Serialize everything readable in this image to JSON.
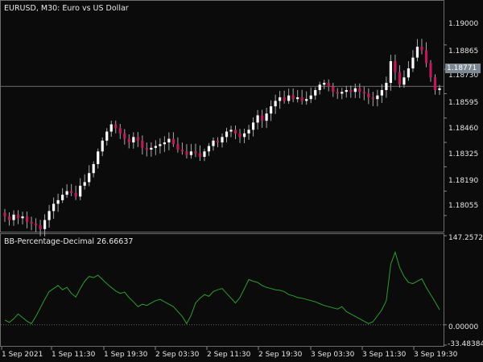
{
  "price_title": "EURUSD, M30:  Euro vs US Dollar",
  "indicator_title": "BB-Percentage-Decimal 26.66637",
  "price_axis": [
    "1.19000",
    "1.18865",
    "1.18730",
    "1.18595",
    "1.18460",
    "1.18325",
    "1.18190",
    "1.18055"
  ],
  "current_price": "1.18771",
  "indicator_axis": [
    "147.25722",
    "0.00000",
    "-33.48384"
  ],
  "time_axis": [
    "1 Sep 2021",
    "1 Sep 11:30",
    "1 Sep 19:30",
    "2 Sep 03:30",
    "2 Sep 11:30",
    "2 Sep 19:30",
    "3 Sep 03:30",
    "3 Sep 11:30",
    "3 Sep 19:30"
  ],
  "colors": {
    "bull": "#ffffff",
    "bear": "#c2185b",
    "wick": "#a8a8a8",
    "indicator": "#2e9e2e",
    "zero": "#666666"
  },
  "chart_data": {
    "type": "candlestick+line",
    "symbol": "EURUSD",
    "timeframe": "M30",
    "price_ylim": [
      1.1797,
      1.1924
    ],
    "indicator_ylim": [
      -33.48384,
      147.25722
    ],
    "current_price": 1.18771,
    "closes": [
      1.1805,
      1.1803,
      1.1806,
      1.1804,
      1.1805,
      1.1802,
      1.1801,
      1.18,
      1.1798,
      1.1803,
      1.1808,
      1.1812,
      1.1814,
      1.1817,
      1.1819,
      1.1818,
      1.1816,
      1.1822,
      1.1824,
      1.1829,
      1.1834,
      1.1841,
      1.1847,
      1.1852,
      1.1856,
      1.1854,
      1.1851,
      1.1848,
      1.1846,
      1.1849,
      1.1847,
      1.1843,
      1.1842,
      1.1843,
      1.1844,
      1.1845,
      1.1846,
      1.1848,
      1.1845,
      1.1842,
      1.1841,
      1.1839,
      1.1841,
      1.184,
      1.1838,
      1.1841,
      1.1844,
      1.1847,
      1.1846,
      1.1849,
      1.1852,
      1.1853,
      1.1851,
      1.1849,
      1.1851,
      1.1853,
      1.1857,
      1.1861,
      1.1858,
      1.1862,
      1.1866,
      1.1869,
      1.1871,
      1.1869,
      1.1872,
      1.187,
      1.1871,
      1.1869,
      1.187,
      1.1872,
      1.1875,
      1.1878,
      1.1879,
      1.1877,
      1.1874,
      1.1873,
      1.1874,
      1.1875,
      1.1874,
      1.1876,
      1.1874,
      1.1873,
      1.1871,
      1.187,
      1.1872,
      1.1875,
      1.1879,
      1.1891,
      1.1885,
      1.1878,
      1.1882,
      1.1887,
      1.1893,
      1.1899,
      1.1897,
      1.189,
      1.1882,
      1.1875,
      1.1876
    ],
    "indicator": [
      8,
      4,
      10,
      18,
      12,
      6,
      2,
      14,
      28,
      42,
      55,
      60,
      65,
      58,
      62,
      52,
      46,
      60,
      72,
      80,
      78,
      82,
      75,
      68,
      62,
      56,
      52,
      54,
      45,
      38,
      30,
      34,
      32,
      36,
      40,
      42,
      38,
      34,
      30,
      22,
      14,
      2,
      16,
      36,
      44,
      50,
      47,
      55,
      58,
      60,
      52,
      44,
      36,
      45,
      60,
      75,
      72,
      70,
      65,
      62,
      60,
      58,
      57,
      55,
      50,
      48,
      45,
      44,
      42,
      40,
      38,
      35,
      32,
      30,
      28,
      26,
      30,
      22,
      18,
      14,
      10,
      6,
      2,
      5,
      15,
      25,
      40,
      100,
      120,
      95,
      80,
      70,
      68,
      72,
      76,
      62,
      50,
      38,
      25
    ],
    "price_ticks": [
      1.19,
      1.18865,
      1.1873,
      1.18595,
      1.1846,
      1.18325,
      1.1819,
      1.18055
    ]
  }
}
